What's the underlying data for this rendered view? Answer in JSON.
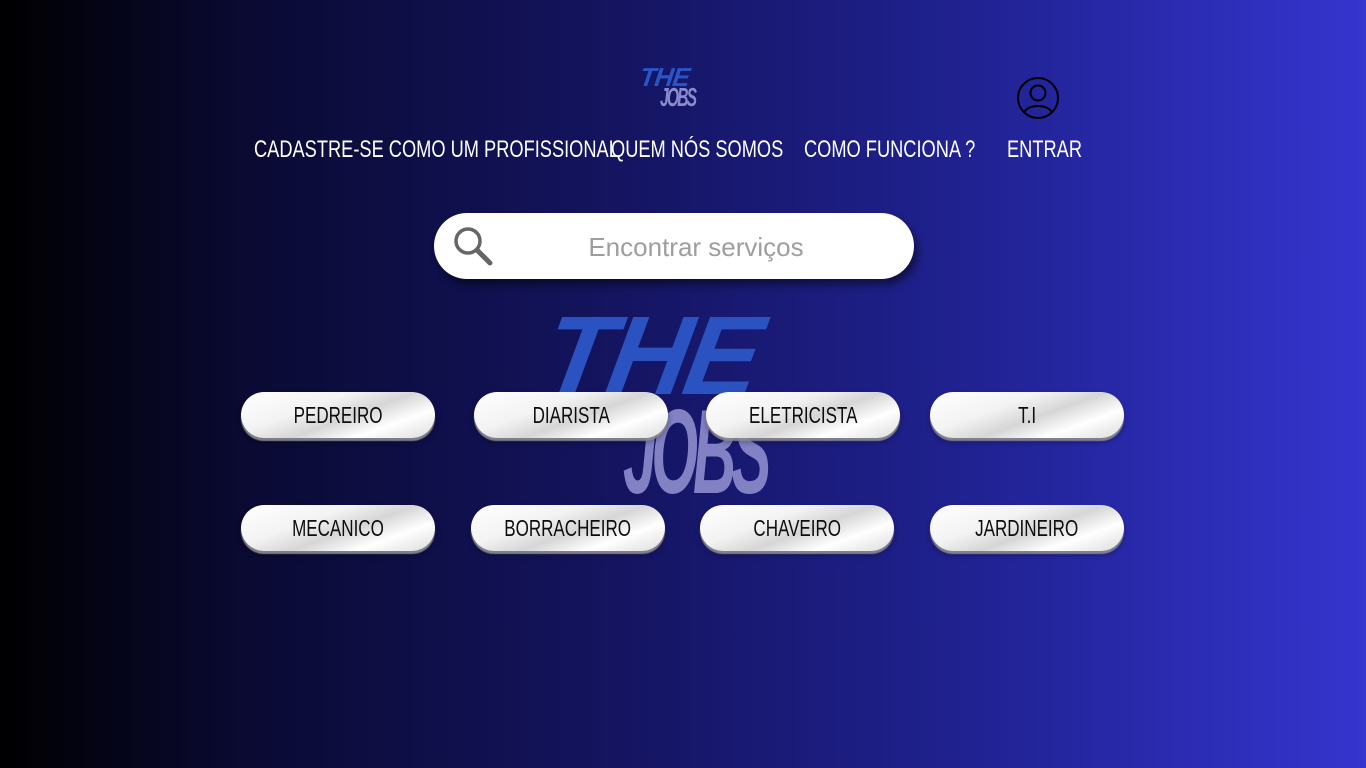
{
  "header": {
    "logo": {
      "top": "THE",
      "bottom": "JOBS"
    },
    "nav": [
      {
        "label": "CADASTRE-SE COMO UM PROFISSIONAL"
      },
      {
        "label": "QUEM NÓS SOMOS"
      },
      {
        "label": "COMO FUNCIONA ?"
      },
      {
        "label": "ENTRAR"
      }
    ],
    "account_icon": "user-circle-icon"
  },
  "search": {
    "placeholder": "Encontrar serviços",
    "value": "",
    "icon": "search-icon"
  },
  "watermark": {
    "top": "THE",
    "bottom": "JOBS"
  },
  "categories": [
    {
      "label": "PEDREIRO"
    },
    {
      "label": "DIARISTA"
    },
    {
      "label": "ELETRICISTA"
    },
    {
      "label": "T.I"
    },
    {
      "label": "MECANICO"
    },
    {
      "label": "BORRACHEIRO"
    },
    {
      "label": "CHAVEIRO"
    },
    {
      "label": "JARDINEIRO"
    }
  ],
  "colors": {
    "background_start": "#000000",
    "background_end": "#3535cf",
    "logo_blue": "#2a55c8",
    "logo_lavender": "#8a8acc",
    "pill": "#f0f0f0",
    "text_light": "#ffffff"
  }
}
